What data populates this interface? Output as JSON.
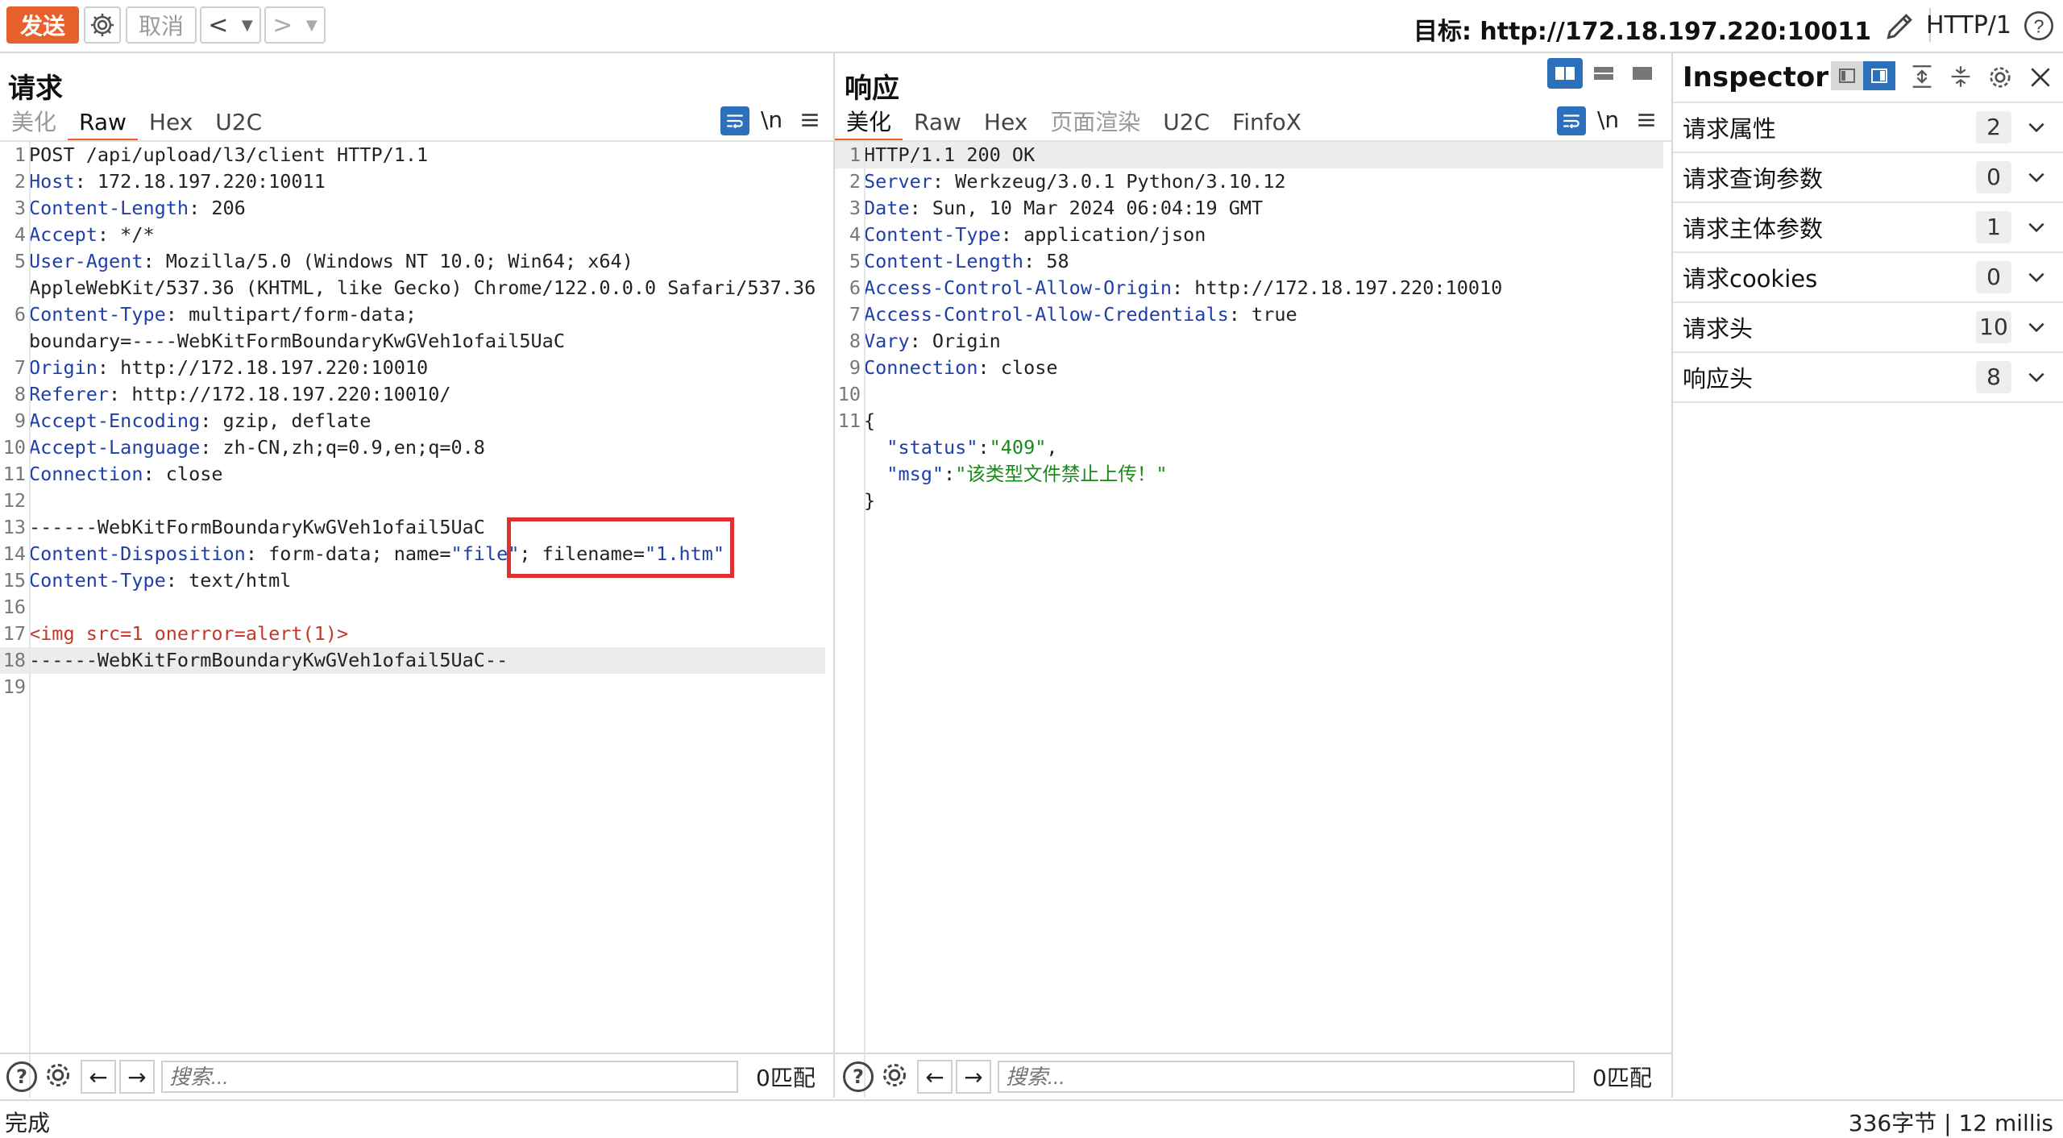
{
  "toolbar": {
    "send_label": "发送",
    "cancel_label": "取消",
    "target_label": "目标: http://172.18.197.220:10011",
    "protocol_label": "HTTP/1"
  },
  "request": {
    "title": "请求",
    "tabs": [
      "美化",
      "Raw",
      "Hex",
      "U2C"
    ],
    "active_tab": "Raw",
    "newline_toggle": "\\n",
    "lines": [
      {
        "n": "1",
        "parts": [
          [
            "t",
            "POST /api/upload/l3/client HTTP/1.1"
          ]
        ]
      },
      {
        "n": "2",
        "parts": [
          [
            "k",
            "Host"
          ],
          [
            "t",
            ": 172.18.197.220:10011"
          ]
        ]
      },
      {
        "n": "3",
        "parts": [
          [
            "k",
            "Content-Length"
          ],
          [
            "t",
            ": 206"
          ]
        ]
      },
      {
        "n": "4",
        "parts": [
          [
            "k",
            "Accept"
          ],
          [
            "t",
            ": */*"
          ]
        ]
      },
      {
        "n": "5",
        "parts": [
          [
            "k",
            "User-Agent"
          ],
          [
            "t",
            ": Mozilla/5.0 (Windows NT 10.0; Win64; x64)"
          ]
        ]
      },
      {
        "n": "",
        "parts": [
          [
            "t",
            "AppleWebKit/537.36 (KHTML, like Gecko) Chrome/122.0.0.0 Safari/537.36"
          ]
        ]
      },
      {
        "n": "6",
        "parts": [
          [
            "k",
            "Content-Type"
          ],
          [
            "t",
            ": multipart/form-data;"
          ]
        ]
      },
      {
        "n": "",
        "parts": [
          [
            "t",
            "boundary=----WebKitFormBoundaryKwGVeh1ofail5UaC"
          ]
        ]
      },
      {
        "n": "7",
        "parts": [
          [
            "k",
            "Origin"
          ],
          [
            "t",
            ": http://172.18.197.220:10010"
          ]
        ]
      },
      {
        "n": "8",
        "parts": [
          [
            "k",
            "Referer"
          ],
          [
            "t",
            ": http://172.18.197.220:10010/"
          ]
        ]
      },
      {
        "n": "9",
        "parts": [
          [
            "k",
            "Accept-Encoding"
          ],
          [
            "t",
            ": gzip, deflate"
          ]
        ]
      },
      {
        "n": "10",
        "parts": [
          [
            "k",
            "Accept-Language"
          ],
          [
            "t",
            ": zh-CN,zh;q=0.9,en;q=0.8"
          ]
        ]
      },
      {
        "n": "11",
        "parts": [
          [
            "k",
            "Connection"
          ],
          [
            "t",
            ": close"
          ]
        ]
      },
      {
        "n": "12",
        "parts": []
      },
      {
        "n": "13",
        "parts": [
          [
            "t",
            "------WebKitFormBoundaryKwGVeh1ofail5UaC"
          ]
        ]
      },
      {
        "n": "14",
        "parts": [
          [
            "k",
            "Content-Disposition"
          ],
          [
            "t",
            ": form-data; name="
          ],
          [
            "s",
            "\"file\""
          ],
          [
            "t",
            "; filename="
          ],
          [
            "s",
            "\"1.htm\""
          ]
        ]
      },
      {
        "n": "15",
        "parts": [
          [
            "k",
            "Content-Type"
          ],
          [
            "t",
            ": text/html"
          ]
        ]
      },
      {
        "n": "16",
        "parts": []
      },
      {
        "n": "17",
        "parts": [
          [
            "r",
            "<img src=1 onerror=alert(1)>"
          ]
        ]
      },
      {
        "n": "18",
        "parts": [
          [
            "t",
            "------WebKitFormBoundaryKwGVeh1ofail5UaC--"
          ]
        ],
        "highlight": true
      },
      {
        "n": "19",
        "parts": []
      }
    ],
    "search_placeholder": "搜索...",
    "match_label": "0匹配"
  },
  "response": {
    "title": "响应",
    "tabs": [
      "美化",
      "Raw",
      "Hex",
      "页面渲染",
      "U2C",
      "FinfoX"
    ],
    "active_tab": "美化",
    "newline_toggle": "\\n",
    "lines": [
      {
        "n": "1",
        "parts": [
          [
            "t",
            "HTTP/1.1 200 OK"
          ]
        ],
        "highlight": true
      },
      {
        "n": "2",
        "parts": [
          [
            "k",
            "Server"
          ],
          [
            "t",
            ": Werkzeug/3.0.1 Python/3.10.12"
          ]
        ]
      },
      {
        "n": "3",
        "parts": [
          [
            "k",
            "Date"
          ],
          [
            "t",
            ": Sun, 10 Mar 2024 06:04:19 GMT"
          ]
        ]
      },
      {
        "n": "4",
        "parts": [
          [
            "k",
            "Content-Type"
          ],
          [
            "t",
            ": application/json"
          ]
        ]
      },
      {
        "n": "5",
        "parts": [
          [
            "k",
            "Content-Length"
          ],
          [
            "t",
            ": 58"
          ]
        ]
      },
      {
        "n": "6",
        "parts": [
          [
            "k",
            "Access-Control-Allow-Origin"
          ],
          [
            "t",
            ": http://172.18.197.220:10010"
          ]
        ]
      },
      {
        "n": "7",
        "parts": [
          [
            "k",
            "Access-Control-Allow-Credentials"
          ],
          [
            "t",
            ": true"
          ]
        ]
      },
      {
        "n": "8",
        "parts": [
          [
            "k",
            "Vary"
          ],
          [
            "t",
            ": Origin"
          ]
        ]
      },
      {
        "n": "9",
        "parts": [
          [
            "k",
            "Connection"
          ],
          [
            "t",
            ": close"
          ]
        ]
      },
      {
        "n": "10",
        "parts": []
      },
      {
        "n": "11",
        "parts": [
          [
            "t",
            "{"
          ]
        ]
      },
      {
        "n": "",
        "parts": [
          [
            "t",
            "  "
          ],
          [
            "k",
            "\"status\""
          ],
          [
            "t",
            ":"
          ],
          [
            "g",
            "\"409\""
          ],
          [
            "t",
            ","
          ]
        ]
      },
      {
        "n": "",
        "parts": [
          [
            "t",
            "  "
          ],
          [
            "k",
            "\"msg\""
          ],
          [
            "t",
            ":"
          ],
          [
            "g",
            "\"该类型文件禁止上传！\""
          ]
        ]
      },
      {
        "n": "",
        "parts": [
          [
            "t",
            "}"
          ]
        ]
      }
    ],
    "search_placeholder": "搜索...",
    "match_label": "0匹配"
  },
  "inspector": {
    "title": "Inspector",
    "rows": [
      {
        "label": "请求属性",
        "count": "2"
      },
      {
        "label": "请求查询参数",
        "count": "0"
      },
      {
        "label": "请求主体参数",
        "count": "1"
      },
      {
        "label": "请求cookies",
        "count": "0"
      },
      {
        "label": "请求头",
        "count": "10"
      },
      {
        "label": "响应头",
        "count": "8"
      }
    ]
  },
  "status_bar": {
    "left_label": "完成",
    "right_label": "336字节 | 12 millis"
  },
  "colors": {
    "accent": "#e8612c",
    "header_key": "#1f3fa8",
    "json_string": "#1a8a1a",
    "html_tag": "#c0392b",
    "active_view": "#2c6fbb",
    "highlight_box": "#e03131"
  },
  "icons": [
    "settings-gear-icon",
    "back-arrow-icon",
    "forward-arrow-icon",
    "pencil-edit-icon",
    "help-icon",
    "wrap-lines-icon",
    "hamburger-menu-icon",
    "layout-split-icon",
    "close-icon"
  ]
}
